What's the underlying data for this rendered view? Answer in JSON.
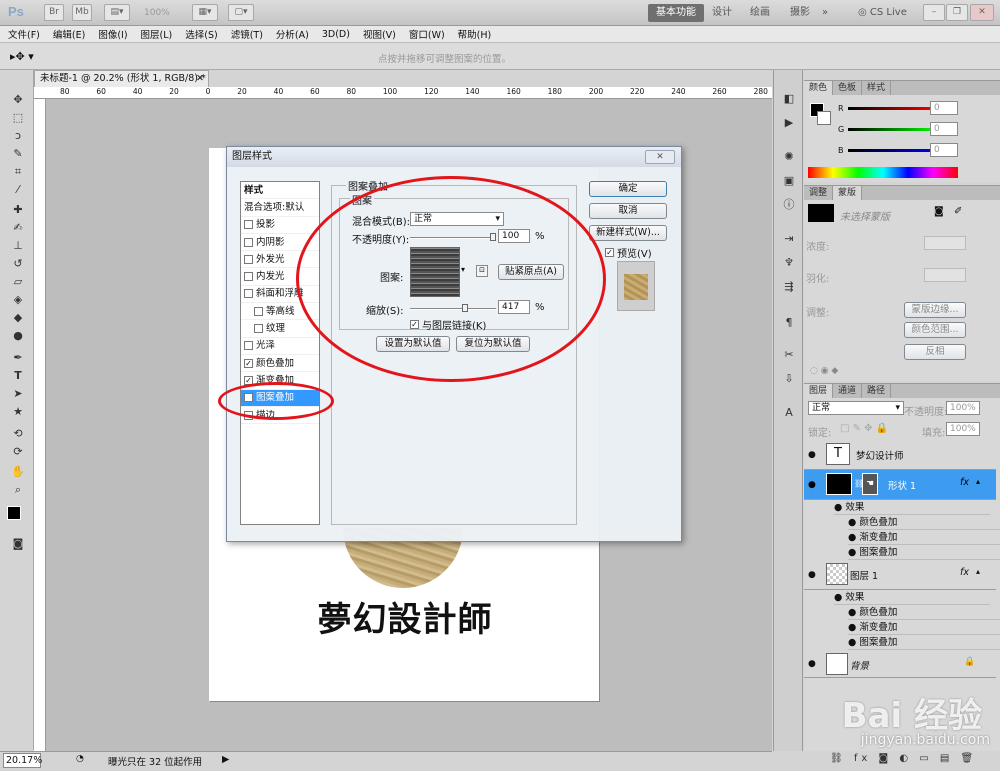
{
  "app": {
    "logo": "Ps",
    "zoom_display": "100%",
    "workspaces": [
      "基本功能",
      "设计",
      "绘画",
      "摄影"
    ],
    "cs_live": "CS Live",
    "menu": [
      "文件(F)",
      "编辑(E)",
      "图像(I)",
      "图层(L)",
      "选择(S)",
      "滤镜(T)",
      "分析(A)",
      "3D(D)",
      "视图(V)",
      "窗口(W)",
      "帮助(H)"
    ],
    "options_hint": "点按并拖移可调整图案的位置。"
  },
  "document": {
    "tab_title": "未标题-1 @ 20.2% (形状 1, RGB/8) *",
    "ruler_marks": [
      "80",
      "60",
      "40",
      "20",
      "0",
      "20",
      "40",
      "60",
      "80",
      "100",
      "120",
      "140",
      "160",
      "180",
      "200",
      "220",
      "240",
      "260",
      "280"
    ],
    "canvas_text": "夢幻設計師"
  },
  "status": {
    "zoom": "20.17%",
    "info": "曝光只在 32 位起作用"
  },
  "dialog": {
    "title": "图层样式",
    "close_label": "✕",
    "styles_header": "样式",
    "blend_default": "混合选项:默认",
    "style_items": [
      {
        "label": "投影",
        "checked": false
      },
      {
        "label": "内阴影",
        "checked": false
      },
      {
        "label": "外发光",
        "checked": false
      },
      {
        "label": "内发光",
        "checked": false
      },
      {
        "label": "斜面和浮雕",
        "checked": false
      },
      {
        "label": "等高线",
        "checked": false
      },
      {
        "label": "纹理",
        "checked": false
      },
      {
        "label": "光泽",
        "checked": false
      },
      {
        "label": "颜色叠加",
        "checked": true
      },
      {
        "label": "渐变叠加",
        "checked": true
      },
      {
        "label": "图案叠加",
        "checked": true
      },
      {
        "label": "描边",
        "checked": false
      }
    ],
    "section_title": "图案叠加",
    "group_title": "图案",
    "blend_mode_label": "混合模式(B):",
    "blend_mode_value": "正常",
    "opacity_label": "不透明度(Y):",
    "opacity_value": "100",
    "percent": "%",
    "pattern_label": "图案:",
    "snap_origin": "贴紧原点(A)",
    "scale_label": "缩放(S):",
    "scale_value": "417",
    "link_layer": "与图层链接(K)",
    "set_default": "设置为默认值",
    "reset_default": "复位为默认值",
    "ok": "确定",
    "cancel": "取消",
    "new_style": "新建样式(W)...",
    "preview": "预览(V)"
  },
  "color_panel": {
    "tabs": [
      "颜色",
      "色板",
      "样式"
    ],
    "channels": [
      {
        "name": "R",
        "value": "0"
      },
      {
        "name": "G",
        "value": "0"
      },
      {
        "name": "B",
        "value": "0"
      }
    ]
  },
  "adjust_panel": {
    "tabs": [
      "调整",
      "蒙版"
    ],
    "no_mask": "未选择蒙版",
    "density": "浓度:",
    "feather": "羽化:",
    "refine": "调整:",
    "mask_edge": "蒙版边缘...",
    "color_range": "颜色范围...",
    "invert": "反相"
  },
  "layers_panel": {
    "tabs": [
      "图层",
      "通道",
      "路径"
    ],
    "blend": "正常",
    "opacity_label": "不透明度:",
    "opacity_value": "100%",
    "lock_label": "锁定:",
    "fill_label": "填充:",
    "fill_value": "100%",
    "effects_label": "效果",
    "layers": [
      {
        "name": "梦幻设计师",
        "type": "text"
      },
      {
        "name": "形状 1",
        "type": "shape",
        "selected": true,
        "effects": [
          "颜色叠加",
          "渐变叠加",
          "图案叠加"
        ]
      },
      {
        "name": "图层 1",
        "type": "pixel",
        "effects": [
          "颜色叠加",
          "渐变叠加",
          "图案叠加"
        ]
      },
      {
        "name": "背景",
        "type": "background"
      }
    ]
  },
  "watermark": {
    "brand": "Bai 经验",
    "url": "jingyan.baidu.com"
  },
  "colors": {
    "accent": "#3399ff",
    "annotation": "#e2151b",
    "layer_selected": "#3d9cf0"
  }
}
